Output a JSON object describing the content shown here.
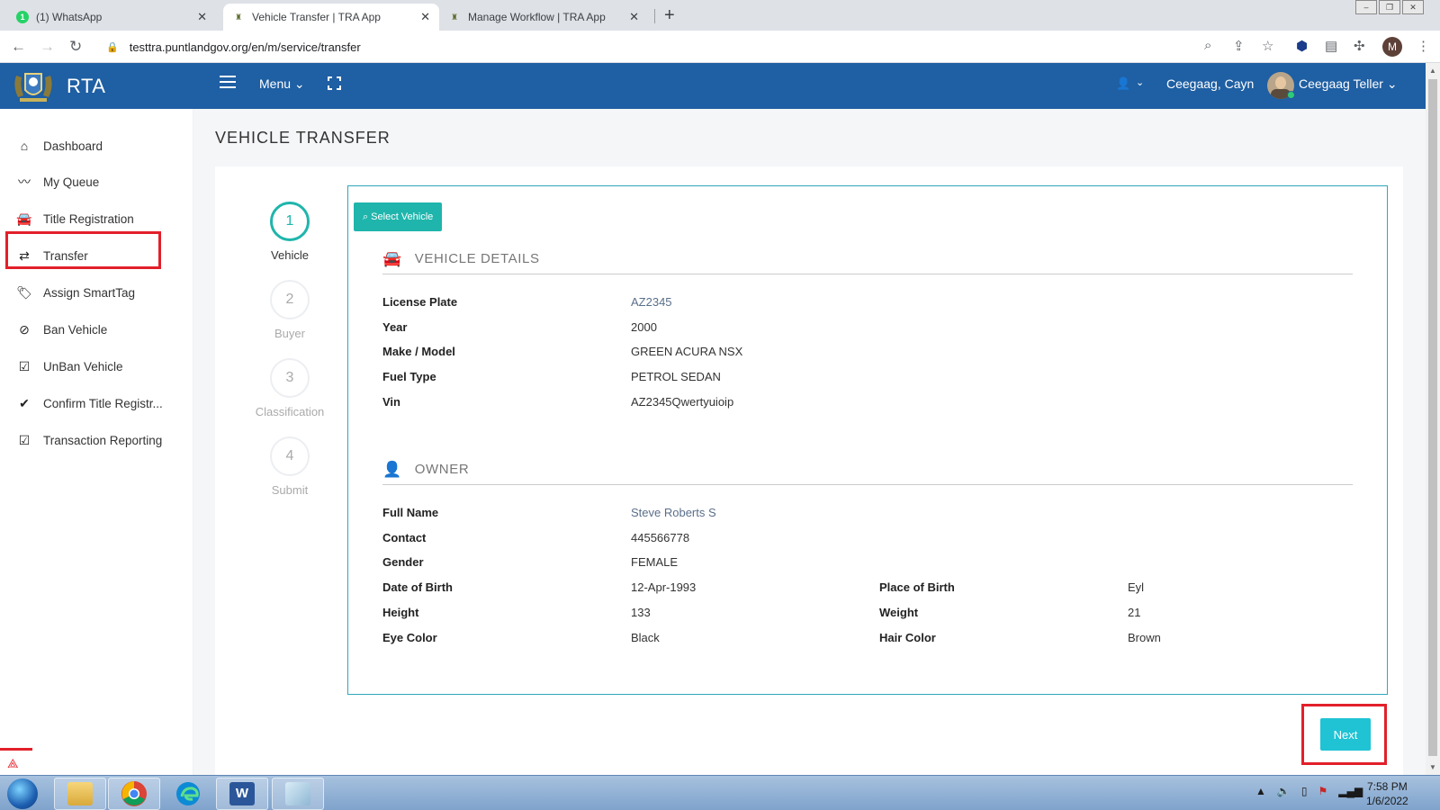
{
  "browser": {
    "tabs": [
      {
        "title": "(1) WhatsApp",
        "favicon": "whatsapp-icon",
        "favicon_text": "1"
      },
      {
        "title": "Vehicle Transfer | TRA App",
        "favicon": "rta-emblem-icon",
        "active": true
      },
      {
        "title": "Manage Workflow | TRA App",
        "favicon": "rta-emblem-icon"
      }
    ],
    "url": "testtra.puntlandgov.org/en/m/service/transfer",
    "profile_initial": "M"
  },
  "header": {
    "brand": "RTA",
    "menu_label": "Menu",
    "user_name": "Ceegaag, Cayn",
    "role_label": "Ceegaag Teller",
    "color": "#1f5fa3"
  },
  "sidebar": {
    "items": [
      {
        "label": "Dashboard",
        "icon": "home-icon"
      },
      {
        "label": "My Queue",
        "icon": "line-chart-icon"
      },
      {
        "label": "Title Registration",
        "icon": "car-icon"
      },
      {
        "label": "Transfer",
        "icon": "exchange-icon",
        "highlighted": true
      },
      {
        "label": "Assign SmartTag",
        "icon": "tags-icon"
      },
      {
        "label": "Ban Vehicle",
        "icon": "ban-icon"
      },
      {
        "label": "UnBan Vehicle",
        "icon": "check-square-icon"
      },
      {
        "label": "Confirm Title Registr...",
        "icon": "check-icon"
      },
      {
        "label": "Transaction Reporting",
        "icon": "check-square-icon"
      }
    ]
  },
  "page": {
    "title": "VEHICLE TRANSFER"
  },
  "wizard": {
    "steps": [
      {
        "number": "1",
        "label": "Vehicle",
        "active": true
      },
      {
        "number": "2",
        "label": "Buyer"
      },
      {
        "number": "3",
        "label": "Classification"
      },
      {
        "number": "4",
        "label": "Submit"
      }
    ],
    "accent_color": "#1fb5ac"
  },
  "select_vehicle_label": "Select Vehicle",
  "vehicle_details": {
    "heading": "VEHICLE DETAILS",
    "fields": [
      {
        "label": "License Plate",
        "value": "AZ2345"
      },
      {
        "label": "Year",
        "value": "2000"
      },
      {
        "label": "Make / Model",
        "value": "GREEN ACURA NSX"
      },
      {
        "label": "Fuel Type",
        "value": "PETROL SEDAN"
      },
      {
        "label": "Vin",
        "value": "AZ2345Qwertyuioip"
      }
    ]
  },
  "owner": {
    "heading": "OWNER",
    "fields": [
      {
        "label": "Full Name",
        "value": "Steve Roberts S"
      },
      {
        "label": "Contact",
        "value": "445566778"
      },
      {
        "label": "Gender",
        "value": "FEMALE"
      },
      {
        "label": "Date of Birth",
        "value": "12-Apr-1993"
      },
      {
        "label": "Place of Birth",
        "value": "Eyl"
      },
      {
        "label": "Height",
        "value": "133"
      },
      {
        "label": "Weight",
        "value": "21"
      },
      {
        "label": "Eye Color",
        "value": "Black"
      },
      {
        "label": "Hair Color",
        "value": "Brown"
      }
    ]
  },
  "next_label": "Next",
  "taskbar": {
    "time": "7:58 PM",
    "date": "1/6/2022"
  }
}
